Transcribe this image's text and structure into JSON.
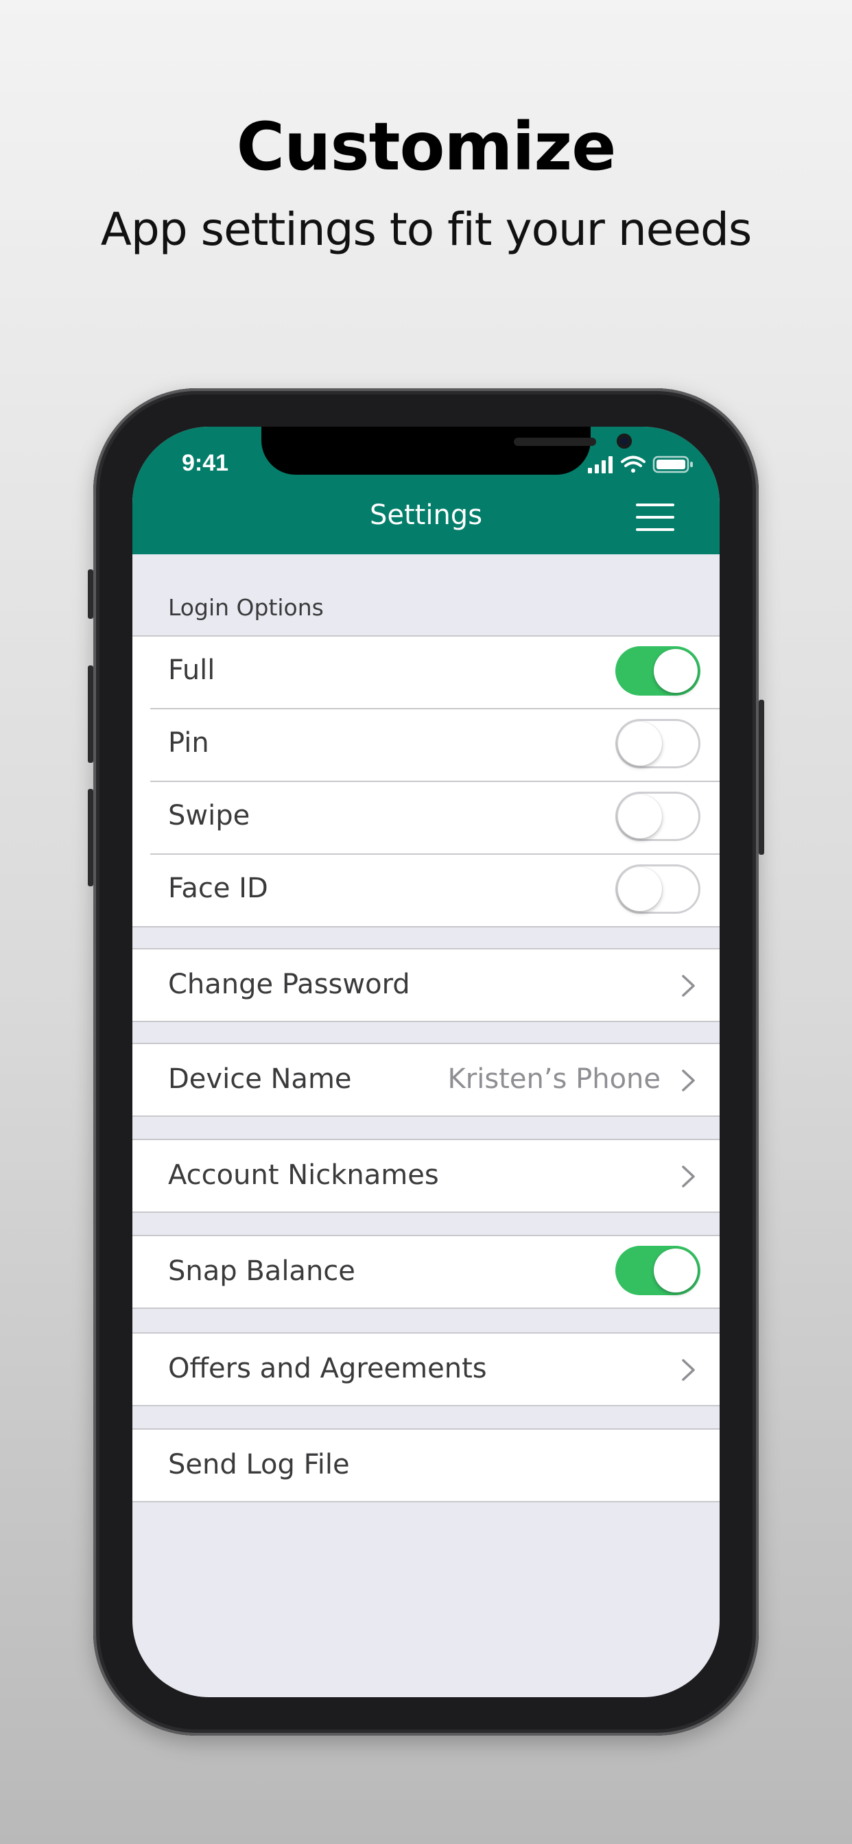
{
  "headline": "Customize",
  "subheadline": "App settings to fit your needs",
  "status_bar": {
    "time": "9:41"
  },
  "nav": {
    "title": "Settings"
  },
  "colors": {
    "header": "#047e6a",
    "toggle_on": "#34c061",
    "background": "#e9e9f2"
  },
  "login_options": {
    "label": "Login Options",
    "items": [
      {
        "label": "Full",
        "enabled": true
      },
      {
        "label": "Pin",
        "enabled": false
      },
      {
        "label": "Swipe",
        "enabled": false
      },
      {
        "label": "Face ID",
        "enabled": false
      }
    ]
  },
  "change_password": {
    "label": "Change Password"
  },
  "device_name": {
    "label": "Device Name",
    "value": "Kristen’s Phone"
  },
  "account_nicknames": {
    "label": "Account Nicknames"
  },
  "snap_balance": {
    "label": "Snap Balance",
    "enabled": true
  },
  "offers": {
    "label": "Offers and Agreements"
  },
  "send_log": {
    "label": "Send Log File"
  }
}
